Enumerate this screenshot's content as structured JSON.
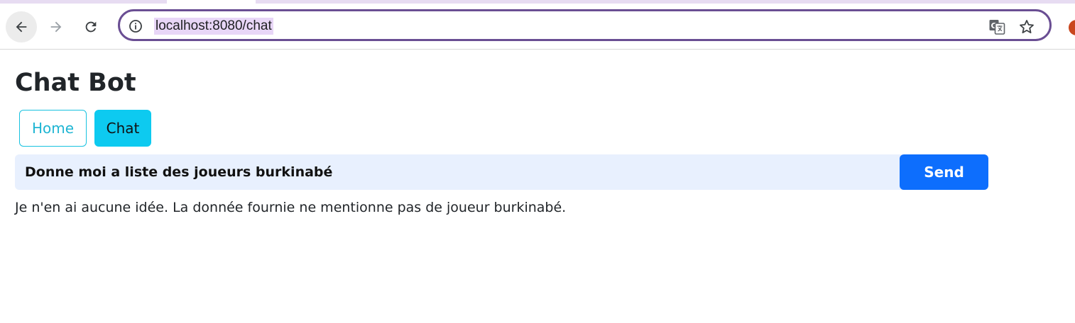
{
  "browser": {
    "url": "localhost:8080/chat",
    "icons": [
      "back-arrow-icon",
      "forward-arrow-icon",
      "reload-icon",
      "info-icon",
      "translate-icon",
      "star-icon"
    ],
    "colors": {
      "omnibox_border": "#6a4e93",
      "url_highlight": "#e8d6f7",
      "avatar": "#c9461e"
    }
  },
  "page": {
    "title": "Chat Bot",
    "nav": [
      {
        "label": "Home",
        "active": false
      },
      {
        "label": "Chat",
        "active": true
      }
    ],
    "chat": {
      "input_value": "Donne moi a liste des joueurs burkinabé",
      "send_label": "Send",
      "response": "Je n'en ai aucune idée. La donnée fournie ne mentionne pas de joueur burkinabé."
    },
    "colors": {
      "accent_info": "#0dcaf0",
      "primary": "#0d6efd",
      "input_bg": "#e8f0fe"
    }
  }
}
